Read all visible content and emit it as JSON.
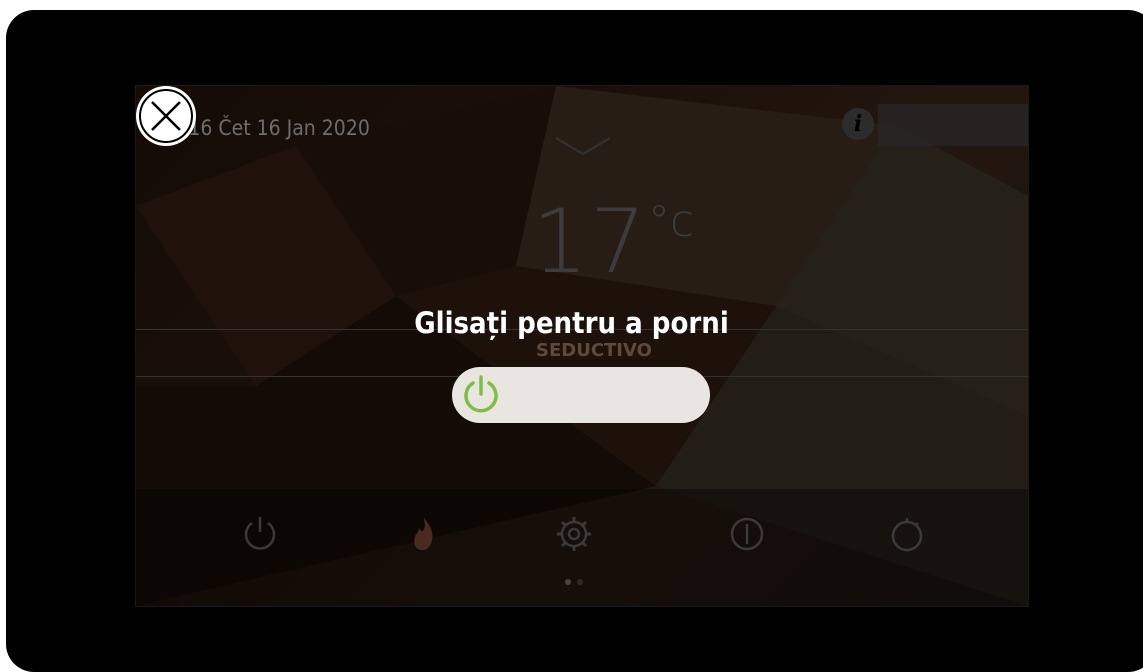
{
  "background_screen": {
    "date_text": ":16 Čet 16 Jan 2020",
    "info_icon": "info-icon",
    "temperature_value": "17",
    "temperature_unit": "°c",
    "mode_text": "SEDUCTIVO",
    "nav_icons": [
      "power-icon",
      "flame-icon",
      "gear-icon",
      "info-circle-icon",
      "timer-icon"
    ]
  },
  "overlay": {
    "close_icon": "close-icon",
    "prompt": "Glisați pentru a porni",
    "slider_icon": "power-icon",
    "slider_progress": 0
  },
  "colors": {
    "accent_green": "#7cc043",
    "overlay_dim": "rgba(0,0,0,0.80)",
    "slider_track": "#e9e6e2"
  }
}
